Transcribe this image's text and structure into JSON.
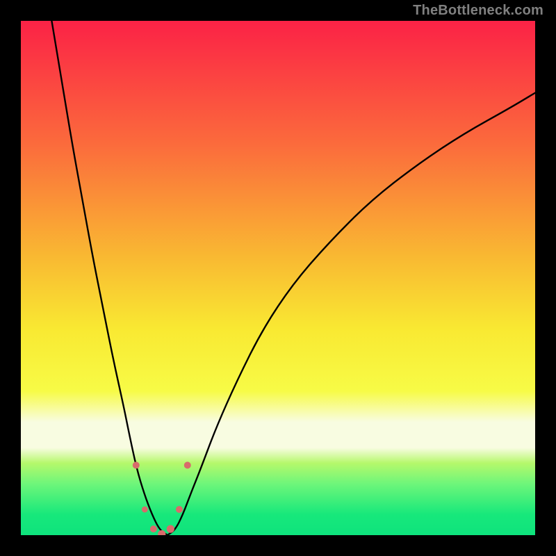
{
  "attribution": "TheBottleneck.com",
  "chart_data": {
    "type": "line",
    "title": "",
    "xlabel": "",
    "ylabel": "",
    "xlim": [
      0,
      100
    ],
    "ylim": [
      0,
      100
    ],
    "gradient_stops": [
      {
        "offset": 0,
        "color": "#fb2246"
      },
      {
        "offset": 24,
        "color": "#fb6b3c"
      },
      {
        "offset": 46,
        "color": "#f9b932"
      },
      {
        "offset": 60,
        "color": "#f9e932"
      },
      {
        "offset": 72,
        "color": "#f7fb46"
      },
      {
        "offset": 78,
        "color": "#f8fce1"
      },
      {
        "offset": 83,
        "color": "#f8fce1"
      },
      {
        "offset": 86,
        "color": "#b5f86b"
      },
      {
        "offset": 90,
        "color": "#6ef67a"
      },
      {
        "offset": 96,
        "color": "#17e87b"
      },
      {
        "offset": 100,
        "color": "#0ee37d"
      }
    ],
    "series": [
      {
        "name": "curve-left",
        "x": [
          6,
          8,
          10,
          12,
          14,
          16,
          18,
          20,
          21,
          22.5,
          24,
          25.5,
          27,
          28.5
        ],
        "y": [
          100,
          88,
          76,
          65,
          54,
          44,
          34,
          25,
          20,
          13,
          8,
          4,
          1,
          0
        ]
      },
      {
        "name": "curve-right",
        "x": [
          28.5,
          30,
          31.5,
          33,
          35,
          38,
          42,
          47,
          53,
          60,
          68,
          77,
          86,
          95,
          100
        ],
        "y": [
          0,
          1,
          4,
          8,
          13,
          21,
          30,
          40,
          49,
          57,
          65,
          72,
          78,
          83,
          86
        ]
      }
    ],
    "markers": {
      "name": "highlight-points",
      "color": "#d86b6b",
      "x": [
        22.4,
        24.1,
        25.8,
        27.4,
        29.1,
        30.8,
        32.4
      ],
      "y": [
        13.6,
        5.0,
        1.2,
        0.2,
        1.2,
        5.0,
        13.6
      ],
      "r": [
        5,
        4.4,
        5,
        5.6,
        5.6,
        5,
        5
      ]
    }
  }
}
